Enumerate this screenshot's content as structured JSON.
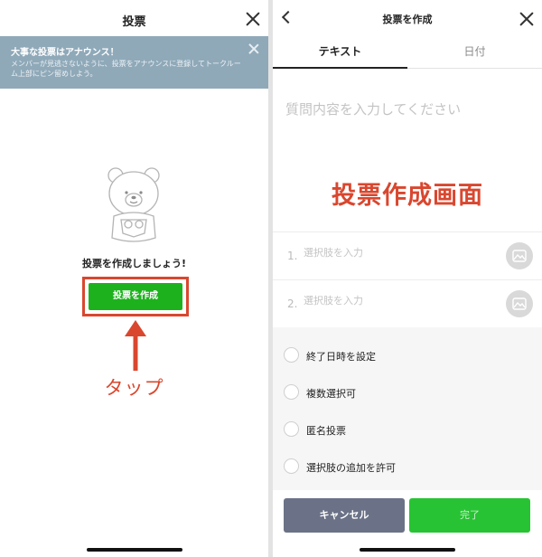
{
  "left_screen": {
    "header": {
      "title": "投票"
    },
    "banner": {
      "title": "大事な投票はアナウンス！",
      "text": "メンバーが見逃さないように、投票をアナウンスに登録してトークルーム上部にピン留めしよう。"
    },
    "empty_state": {
      "text": "投票を作成しましょう!"
    },
    "create_button_label": "投票を作成",
    "annotation": {
      "tap_label": "タップ"
    }
  },
  "right_screen": {
    "header": {
      "title": "投票を作成"
    },
    "tabs": [
      {
        "label": "テキスト",
        "active": true
      },
      {
        "label": "日付",
        "active": false
      }
    ],
    "question_placeholder": "質問内容を入力してください",
    "annotation": {
      "overlay_label": "投票作成画面"
    },
    "options": [
      {
        "number": "1.",
        "placeholder": "選択肢を入力"
      },
      {
        "number": "2.",
        "placeholder": "選択肢を入力"
      }
    ],
    "settings": [
      {
        "label": "終了日時を設定"
      },
      {
        "label": "複数選択可"
      },
      {
        "label": "匿名投票"
      },
      {
        "label": "選択肢の追加を許可"
      }
    ],
    "buttons": {
      "cancel": "キャンセル",
      "done": "完了"
    }
  },
  "colors": {
    "line_green": "#1db21d",
    "annotation_red": "#d9472f",
    "banner_blue_gray": "#8fa9b9",
    "cancel_gray": "#6b7287"
  },
  "icons": [
    "close-icon",
    "back-icon",
    "bear-icon",
    "arrow-up-icon",
    "image-icon"
  ]
}
